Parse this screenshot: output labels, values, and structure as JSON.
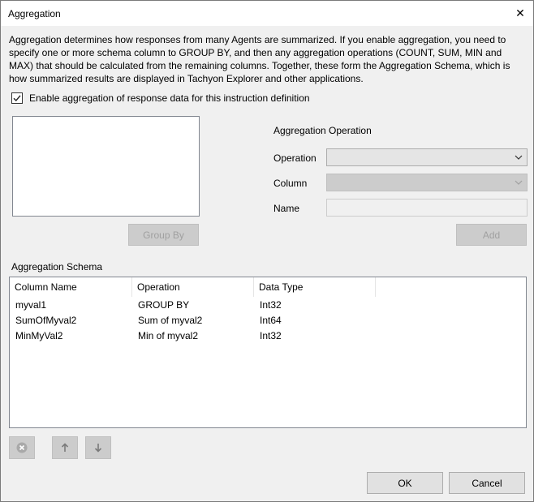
{
  "window": {
    "title": "Aggregation",
    "close_glyph": "✕"
  },
  "description": "Aggregation determines how responses from many Agents are summarized. If you enable aggregation, you need to specify one or more schema column to GROUP BY, and then any aggregation operations (COUNT, SUM, MIN and MAX) that should be calculated from the remaining columns. Together, these form the Aggregation Schema, which is how summarized results are displayed in Tachyon Explorer and other applications.",
  "enable_checkbox": {
    "label": "Enable aggregation of response data for this instruction definition",
    "checked": true
  },
  "columns_list": {
    "items": []
  },
  "group_by_button": {
    "label": "Group By",
    "enabled": false
  },
  "aggregation_operation": {
    "heading": "Aggregation Operation",
    "operation_label": "Operation",
    "operation_value": "",
    "column_label": "Column",
    "column_value": "",
    "name_label": "Name",
    "name_value": "",
    "add_label": "Add"
  },
  "schema": {
    "heading": "Aggregation Schema",
    "columns": [
      "Column Name",
      "Operation",
      "Data Type"
    ],
    "rows": [
      [
        "myval1",
        "GROUP BY",
        "Int32"
      ],
      [
        "SumOfMyval2",
        "Sum of myval2",
        "Int64"
      ],
      [
        "MinMyVal2",
        "Min of myval2",
        "Int32"
      ]
    ]
  },
  "toolbar": {
    "remove_icon": "remove-icon",
    "up_icon": "arrow-up-icon",
    "down_icon": "arrow-down-icon"
  },
  "footer": {
    "ok_label": "OK",
    "cancel_label": "Cancel"
  }
}
